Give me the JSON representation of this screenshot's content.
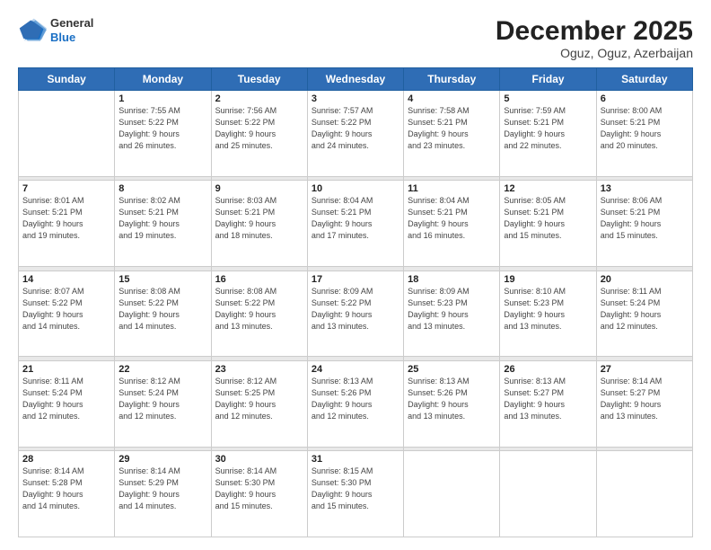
{
  "header": {
    "logo_general": "General",
    "logo_blue": "Blue",
    "month_title": "December 2025",
    "subtitle": "Oguz, Oguz, Azerbaijan"
  },
  "days_of_week": [
    "Sunday",
    "Monday",
    "Tuesday",
    "Wednesday",
    "Thursday",
    "Friday",
    "Saturday"
  ],
  "weeks": [
    [
      {
        "day": "",
        "info": ""
      },
      {
        "day": "1",
        "info": "Sunrise: 7:55 AM\nSunset: 5:22 PM\nDaylight: 9 hours\nand 26 minutes."
      },
      {
        "day": "2",
        "info": "Sunrise: 7:56 AM\nSunset: 5:22 PM\nDaylight: 9 hours\nand 25 minutes."
      },
      {
        "day": "3",
        "info": "Sunrise: 7:57 AM\nSunset: 5:22 PM\nDaylight: 9 hours\nand 24 minutes."
      },
      {
        "day": "4",
        "info": "Sunrise: 7:58 AM\nSunset: 5:21 PM\nDaylight: 9 hours\nand 23 minutes."
      },
      {
        "day": "5",
        "info": "Sunrise: 7:59 AM\nSunset: 5:21 PM\nDaylight: 9 hours\nand 22 minutes."
      },
      {
        "day": "6",
        "info": "Sunrise: 8:00 AM\nSunset: 5:21 PM\nDaylight: 9 hours\nand 20 minutes."
      }
    ],
    [
      {
        "day": "7",
        "info": "Sunrise: 8:01 AM\nSunset: 5:21 PM\nDaylight: 9 hours\nand 19 minutes."
      },
      {
        "day": "8",
        "info": "Sunrise: 8:02 AM\nSunset: 5:21 PM\nDaylight: 9 hours\nand 19 minutes."
      },
      {
        "day": "9",
        "info": "Sunrise: 8:03 AM\nSunset: 5:21 PM\nDaylight: 9 hours\nand 18 minutes."
      },
      {
        "day": "10",
        "info": "Sunrise: 8:04 AM\nSunset: 5:21 PM\nDaylight: 9 hours\nand 17 minutes."
      },
      {
        "day": "11",
        "info": "Sunrise: 8:04 AM\nSunset: 5:21 PM\nDaylight: 9 hours\nand 16 minutes."
      },
      {
        "day": "12",
        "info": "Sunrise: 8:05 AM\nSunset: 5:21 PM\nDaylight: 9 hours\nand 15 minutes."
      },
      {
        "day": "13",
        "info": "Sunrise: 8:06 AM\nSunset: 5:21 PM\nDaylight: 9 hours\nand 15 minutes."
      }
    ],
    [
      {
        "day": "14",
        "info": "Sunrise: 8:07 AM\nSunset: 5:22 PM\nDaylight: 9 hours\nand 14 minutes."
      },
      {
        "day": "15",
        "info": "Sunrise: 8:08 AM\nSunset: 5:22 PM\nDaylight: 9 hours\nand 14 minutes."
      },
      {
        "day": "16",
        "info": "Sunrise: 8:08 AM\nSunset: 5:22 PM\nDaylight: 9 hours\nand 13 minutes."
      },
      {
        "day": "17",
        "info": "Sunrise: 8:09 AM\nSunset: 5:22 PM\nDaylight: 9 hours\nand 13 minutes."
      },
      {
        "day": "18",
        "info": "Sunrise: 8:09 AM\nSunset: 5:23 PM\nDaylight: 9 hours\nand 13 minutes."
      },
      {
        "day": "19",
        "info": "Sunrise: 8:10 AM\nSunset: 5:23 PM\nDaylight: 9 hours\nand 13 minutes."
      },
      {
        "day": "20",
        "info": "Sunrise: 8:11 AM\nSunset: 5:24 PM\nDaylight: 9 hours\nand 12 minutes."
      }
    ],
    [
      {
        "day": "21",
        "info": "Sunrise: 8:11 AM\nSunset: 5:24 PM\nDaylight: 9 hours\nand 12 minutes."
      },
      {
        "day": "22",
        "info": "Sunrise: 8:12 AM\nSunset: 5:24 PM\nDaylight: 9 hours\nand 12 minutes."
      },
      {
        "day": "23",
        "info": "Sunrise: 8:12 AM\nSunset: 5:25 PM\nDaylight: 9 hours\nand 12 minutes."
      },
      {
        "day": "24",
        "info": "Sunrise: 8:13 AM\nSunset: 5:26 PM\nDaylight: 9 hours\nand 12 minutes."
      },
      {
        "day": "25",
        "info": "Sunrise: 8:13 AM\nSunset: 5:26 PM\nDaylight: 9 hours\nand 13 minutes."
      },
      {
        "day": "26",
        "info": "Sunrise: 8:13 AM\nSunset: 5:27 PM\nDaylight: 9 hours\nand 13 minutes."
      },
      {
        "day": "27",
        "info": "Sunrise: 8:14 AM\nSunset: 5:27 PM\nDaylight: 9 hours\nand 13 minutes."
      }
    ],
    [
      {
        "day": "28",
        "info": "Sunrise: 8:14 AM\nSunset: 5:28 PM\nDaylight: 9 hours\nand 14 minutes."
      },
      {
        "day": "29",
        "info": "Sunrise: 8:14 AM\nSunset: 5:29 PM\nDaylight: 9 hours\nand 14 minutes."
      },
      {
        "day": "30",
        "info": "Sunrise: 8:14 AM\nSunset: 5:30 PM\nDaylight: 9 hours\nand 15 minutes."
      },
      {
        "day": "31",
        "info": "Sunrise: 8:15 AM\nSunset: 5:30 PM\nDaylight: 9 hours\nand 15 minutes."
      },
      {
        "day": "",
        "info": ""
      },
      {
        "day": "",
        "info": ""
      },
      {
        "day": "",
        "info": ""
      }
    ]
  ]
}
